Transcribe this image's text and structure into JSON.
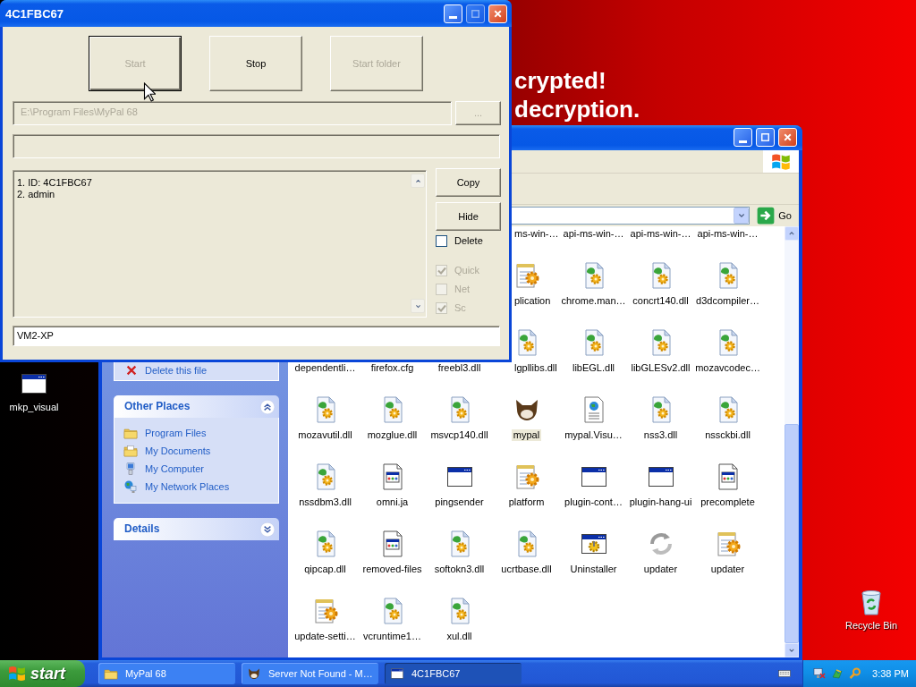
{
  "wallpaper": {
    "lines": [
      "crypted!",
      "decryption."
    ]
  },
  "desktop_icons": [
    {
      "label": "mkp_visual",
      "kind": "window"
    },
    {
      "label": "Recycle Bin",
      "kind": "recycle"
    }
  ],
  "explorer": {
    "window_buttons": [
      {
        "kind": "minimize"
      },
      {
        "kind": "maximize"
      },
      {
        "kind": "close"
      }
    ],
    "go_button": "Go",
    "file_tasks": [
      {
        "label": "Delete this file",
        "kind": "delete"
      }
    ],
    "sections": [
      {
        "title": "Other Places",
        "expanded": true,
        "links": [
          {
            "label": "Program Files",
            "kind": "folder"
          },
          {
            "label": "My Documents",
            "kind": "documents"
          },
          {
            "label": "My Computer",
            "kind": "computer"
          },
          {
            "label": "My Network Places",
            "kind": "network"
          }
        ]
      },
      {
        "title": "Details",
        "expanded": false
      }
    ],
    "file_rows": [
      [
        null,
        null,
        null,
        {
          "label": "ms-win-…",
          "partial": true,
          "selected": false
        },
        {
          "label": "api-ms-win-…",
          "selected": false
        },
        {
          "label": "api-ms-win-…",
          "selected": false
        },
        {
          "label": "api-ms-win-…",
          "selected": false
        }
      ],
      [
        null,
        null,
        null,
        {
          "label": "plication",
          "kind": "config",
          "partial": true,
          "selected": false
        },
        {
          "label": "chrome.man…",
          "kind": "dll",
          "selected": false
        },
        {
          "label": "concrt140.dll",
          "kind": "dll",
          "selected": false
        },
        {
          "label": "d3dcompiler…",
          "kind": "dll",
          "selected": false
        }
      ],
      [
        {
          "label": "dependentli…",
          "selected": false
        },
        {
          "label": "firefox.cfg",
          "selected": false
        },
        {
          "label": "freebl3.dll",
          "selected": false
        },
        {
          "label": "lgpllibs.dll",
          "kind": "dll",
          "partial": true,
          "selected": false
        },
        {
          "label": "libEGL.dll",
          "kind": "dll",
          "selected": false
        },
        {
          "label": "libGLESv2.dll",
          "kind": "dll",
          "selected": false
        },
        {
          "label": "mozavcodec…",
          "kind": "dll",
          "selected": false
        }
      ],
      [
        {
          "label": "mozavutil.dll",
          "kind": "dll",
          "selected": false
        },
        {
          "label": "mozglue.dll",
          "kind": "dll",
          "selected": false
        },
        {
          "label": "msvcp140.dll",
          "kind": "dll",
          "selected": false
        },
        {
          "label": "mypal",
          "kind": "animal",
          "selected": true
        },
        {
          "label": "mypal.Visu…",
          "kind": "web-doc",
          "selected": false
        },
        {
          "label": "nss3.dll",
          "kind": "dll",
          "selected": false
        },
        {
          "label": "nssckbi.dll",
          "kind": "dll",
          "selected": false
        }
      ],
      [
        {
          "label": "nssdbm3.dll",
          "kind": "dll",
          "selected": false
        },
        {
          "label": "omni.ja",
          "kind": "doc-window",
          "selected": false
        },
        {
          "label": "pingsender",
          "kind": "window",
          "selected": false
        },
        {
          "label": "platform",
          "kind": "config",
          "selected": false
        },
        {
          "label": "plugin-cont…",
          "kind": "window",
          "selected": false
        },
        {
          "label": "plugin-hang-ui",
          "kind": "window",
          "selected": false
        },
        {
          "label": "precomplete",
          "kind": "doc-window",
          "selected": false
        }
      ],
      [
        {
          "label": "qipcap.dll",
          "kind": "dll",
          "selected": false
        },
        {
          "label": "removed-files",
          "kind": "doc-window",
          "selected": false
        },
        {
          "label": "softokn3.dll",
          "kind": "dll",
          "selected": false
        },
        {
          "label": "ucrtbase.dll",
          "kind": "dll",
          "selected": false
        },
        {
          "label": "Uninstaller",
          "kind": "installer",
          "selected": false
        },
        {
          "label": "updater",
          "kind": "updater",
          "selected": false
        },
        {
          "label": "updater",
          "kind": "config",
          "selected": false
        }
      ],
      [
        {
          "label": "update-setti…",
          "kind": "config",
          "selected": false
        },
        {
          "label": "vcruntime1…",
          "kind": "dll",
          "selected": false
        },
        {
          "label": "xul.dll",
          "kind": "dll",
          "selected": false
        }
      ]
    ]
  },
  "dialog": {
    "title": "4C1FBC67",
    "window_buttons": [
      {
        "kind": "minimize",
        "disabled": false
      },
      {
        "kind": "maximize",
        "disabled": true
      },
      {
        "kind": "close",
        "disabled": false
      }
    ],
    "actions": [
      {
        "label": "Start",
        "disabled": true,
        "default": true
      },
      {
        "label": "Stop",
        "disabled": false,
        "default": false
      },
      {
        "label": "Start folder",
        "disabled": true,
        "default": false
      }
    ],
    "path_field": {
      "value": "E:\\Program Files\\MyPal 68",
      "disabled": true
    },
    "browse_button": {
      "label": "...",
      "disabled": true
    },
    "log": [
      "1. ID: 4C1FBC67",
      "2. admin"
    ],
    "side_buttons": [
      {
        "label": "Copy",
        "disabled": false
      },
      {
        "label": "Hide",
        "disabled": false
      }
    ],
    "delete_option": {
      "label": "Delete",
      "checked": false,
      "disabled": false
    },
    "options": [
      {
        "label": "Quick",
        "checked": true,
        "disabled": true
      },
      {
        "label": "Net",
        "checked": false,
        "disabled": true
      },
      {
        "label": "Sc",
        "checked": true,
        "disabled": true
      }
    ],
    "name_field": {
      "value": "VM2-XP"
    }
  },
  "taskbar": {
    "start": "start",
    "tasks": [
      {
        "label": "MyPal 68",
        "kind": "folder",
        "selected": false
      },
      {
        "label": "Server Not Found - M…",
        "kind": "animal",
        "selected": false
      },
      {
        "label": "4C1FBC67",
        "kind": "window",
        "selected": true
      }
    ],
    "clock": "3:38 PM"
  }
}
